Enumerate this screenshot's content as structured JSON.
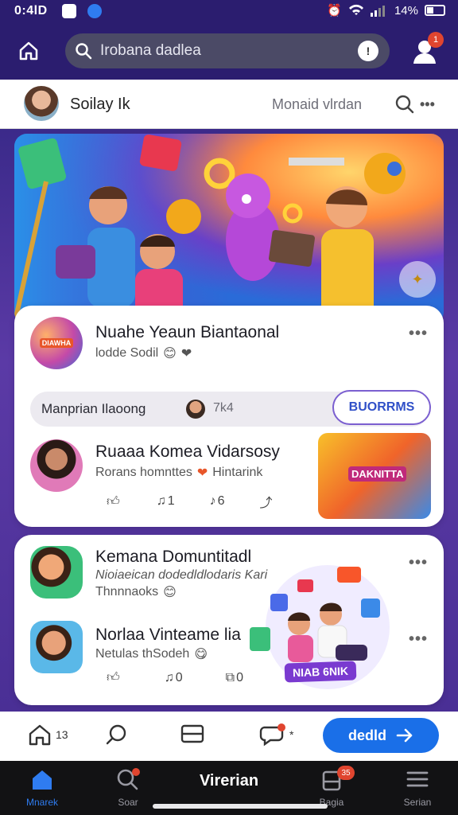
{
  "status_bar": {
    "time": "0:4lD",
    "battery": "14%"
  },
  "top_bar": {
    "search_text": "Irobana dadlea",
    "search_right_glyph": "!",
    "notification_count": "1"
  },
  "profile": {
    "name": "Soilay Ik",
    "secondary": "Monaid vlrdan"
  },
  "feed": {
    "post1": {
      "title": "Nuahe Yeaun Biantaonal",
      "subtitle": "lodde Sodil",
      "thumb_text": "DIAWHA"
    },
    "pill": {
      "label": "Manprian Ilaoong",
      "count": "7k4",
      "button": "BUORRMS"
    },
    "post2": {
      "title": "Ruaaa Komea Vidarsosy",
      "subtitle": "Rorans homnttes",
      "subtitle_tail": "Hintarink",
      "thumb_text": "DAKNITTA",
      "reacts": [
        "",
        "1",
        "6",
        ""
      ]
    },
    "post3": {
      "title": "Kemana Domuntitadl",
      "line2": "Nioiaeican dodedldlodaris Kari",
      "line3": "Thnnnaoks"
    },
    "post4": {
      "title": "Norlaa Vinteame lia",
      "subtitle": "Netulas thSodeh",
      "sticker_text": "NIAB 6NIK",
      "reacts": [
        "",
        "0",
        "0"
      ]
    }
  },
  "action_bar": {
    "home_count": "13",
    "chat_count": "*",
    "primary_label": "dedld"
  },
  "bottom_nav": {
    "items": [
      {
        "label": "Mnarek",
        "icon": "home-icon"
      },
      {
        "label": "Soar",
        "icon": "search-icon"
      },
      {
        "label": "Bagia",
        "icon": "inbox-icon",
        "badge": "35"
      },
      {
        "label": "Serian",
        "icon": "menu-icon"
      }
    ],
    "center_title": "Virerian"
  },
  "colors": {
    "accent": "#1a6fe8",
    "header": "#2b1d6f",
    "badge": "#e0452f"
  }
}
